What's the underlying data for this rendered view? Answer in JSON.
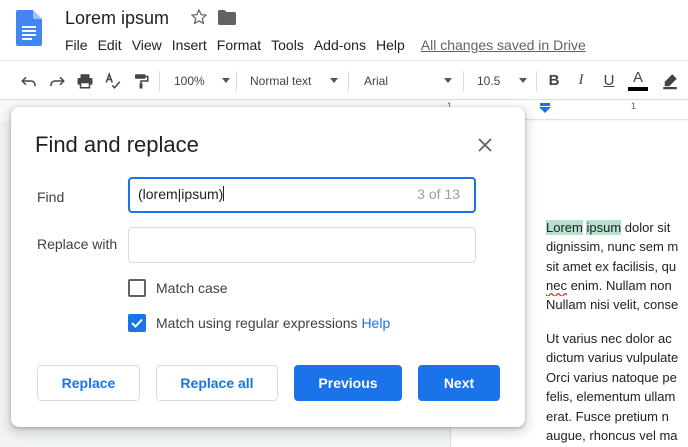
{
  "header": {
    "doc_title": "Lorem ipsum",
    "menu": [
      "File",
      "Edit",
      "View",
      "Insert",
      "Format",
      "Tools",
      "Add-ons",
      "Help"
    ],
    "save_status": "All changes saved in Drive"
  },
  "toolbar": {
    "zoom": "100%",
    "style": "Normal text",
    "font": "Arial",
    "font_size": "10.5",
    "bold": "B",
    "italic": "I",
    "underline": "U",
    "text_color": "A"
  },
  "ruler": {
    "numbers": [
      "1",
      "1"
    ]
  },
  "document": {
    "para1": {
      "highlight1": "Lorem",
      "highlight2": "ipsum",
      "line1_rest": " dolor sit",
      "line2": "dignissim, nunc sem m",
      "line3": "sit amet ex facilisis, qu",
      "line4_squiggle": "nec",
      "line4_rest": " enim. Nullam non",
      "line5": "Nullam nisi velit, conse"
    },
    "para2": {
      "lines": [
        "Ut varius nec dolor ac",
        "dictum varius vulpulate",
        "Orci varius natoque pe",
        "felis, elementum ullam",
        "erat. Fusce pretium n",
        "augue, rhoncus vel ma"
      ]
    },
    "highlight_color": "#b7e1cd"
  },
  "dialog": {
    "title": "Find and replace",
    "find_label": "Find",
    "find_value_before_caret": "(lorem|ipsum)",
    "find_count": "3 of 13",
    "replace_label": "Replace with",
    "replace_value": "",
    "match_case_label": "Match case",
    "match_case_checked": false,
    "regex_label": "Match using regular expressions",
    "regex_checked": true,
    "help_link": "Help",
    "buttons": {
      "replace": "Replace",
      "replace_all": "Replace all",
      "previous": "Previous",
      "next": "Next"
    },
    "accent_color": "#1a73e8"
  }
}
